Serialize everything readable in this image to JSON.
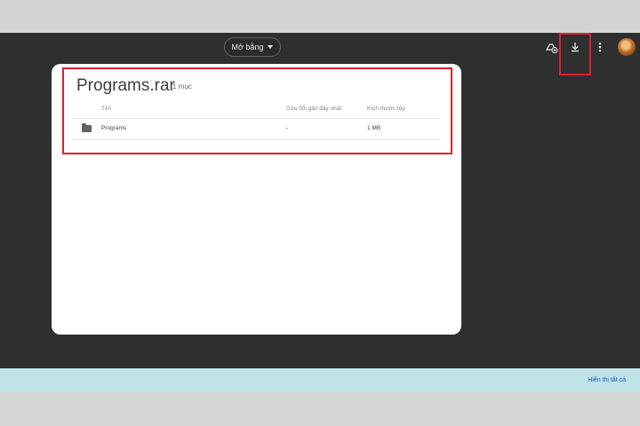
{
  "toolbar": {
    "open_with_label": "Mở bằng",
    "icons": [
      "add-to-drive-icon",
      "download-icon",
      "more-vert-icon"
    ]
  },
  "archive": {
    "title": "Programs.rar",
    "item_count": "1 mục",
    "columns": {
      "name": "Tên",
      "modified": "Sửa đổi gần đây nhất",
      "size": "Kích thước tệp"
    },
    "rows": [
      {
        "name": "Programs",
        "modified": "-",
        "size": "1 MB"
      }
    ]
  },
  "bottom_bar": {
    "show_all_label": "Hiển thị tất cả"
  },
  "colors": {
    "viewer_bg": "#2f2f2f",
    "highlight": "#e0202d",
    "bar_bg": "#bfe3e9",
    "link": "#1a56b8"
  }
}
